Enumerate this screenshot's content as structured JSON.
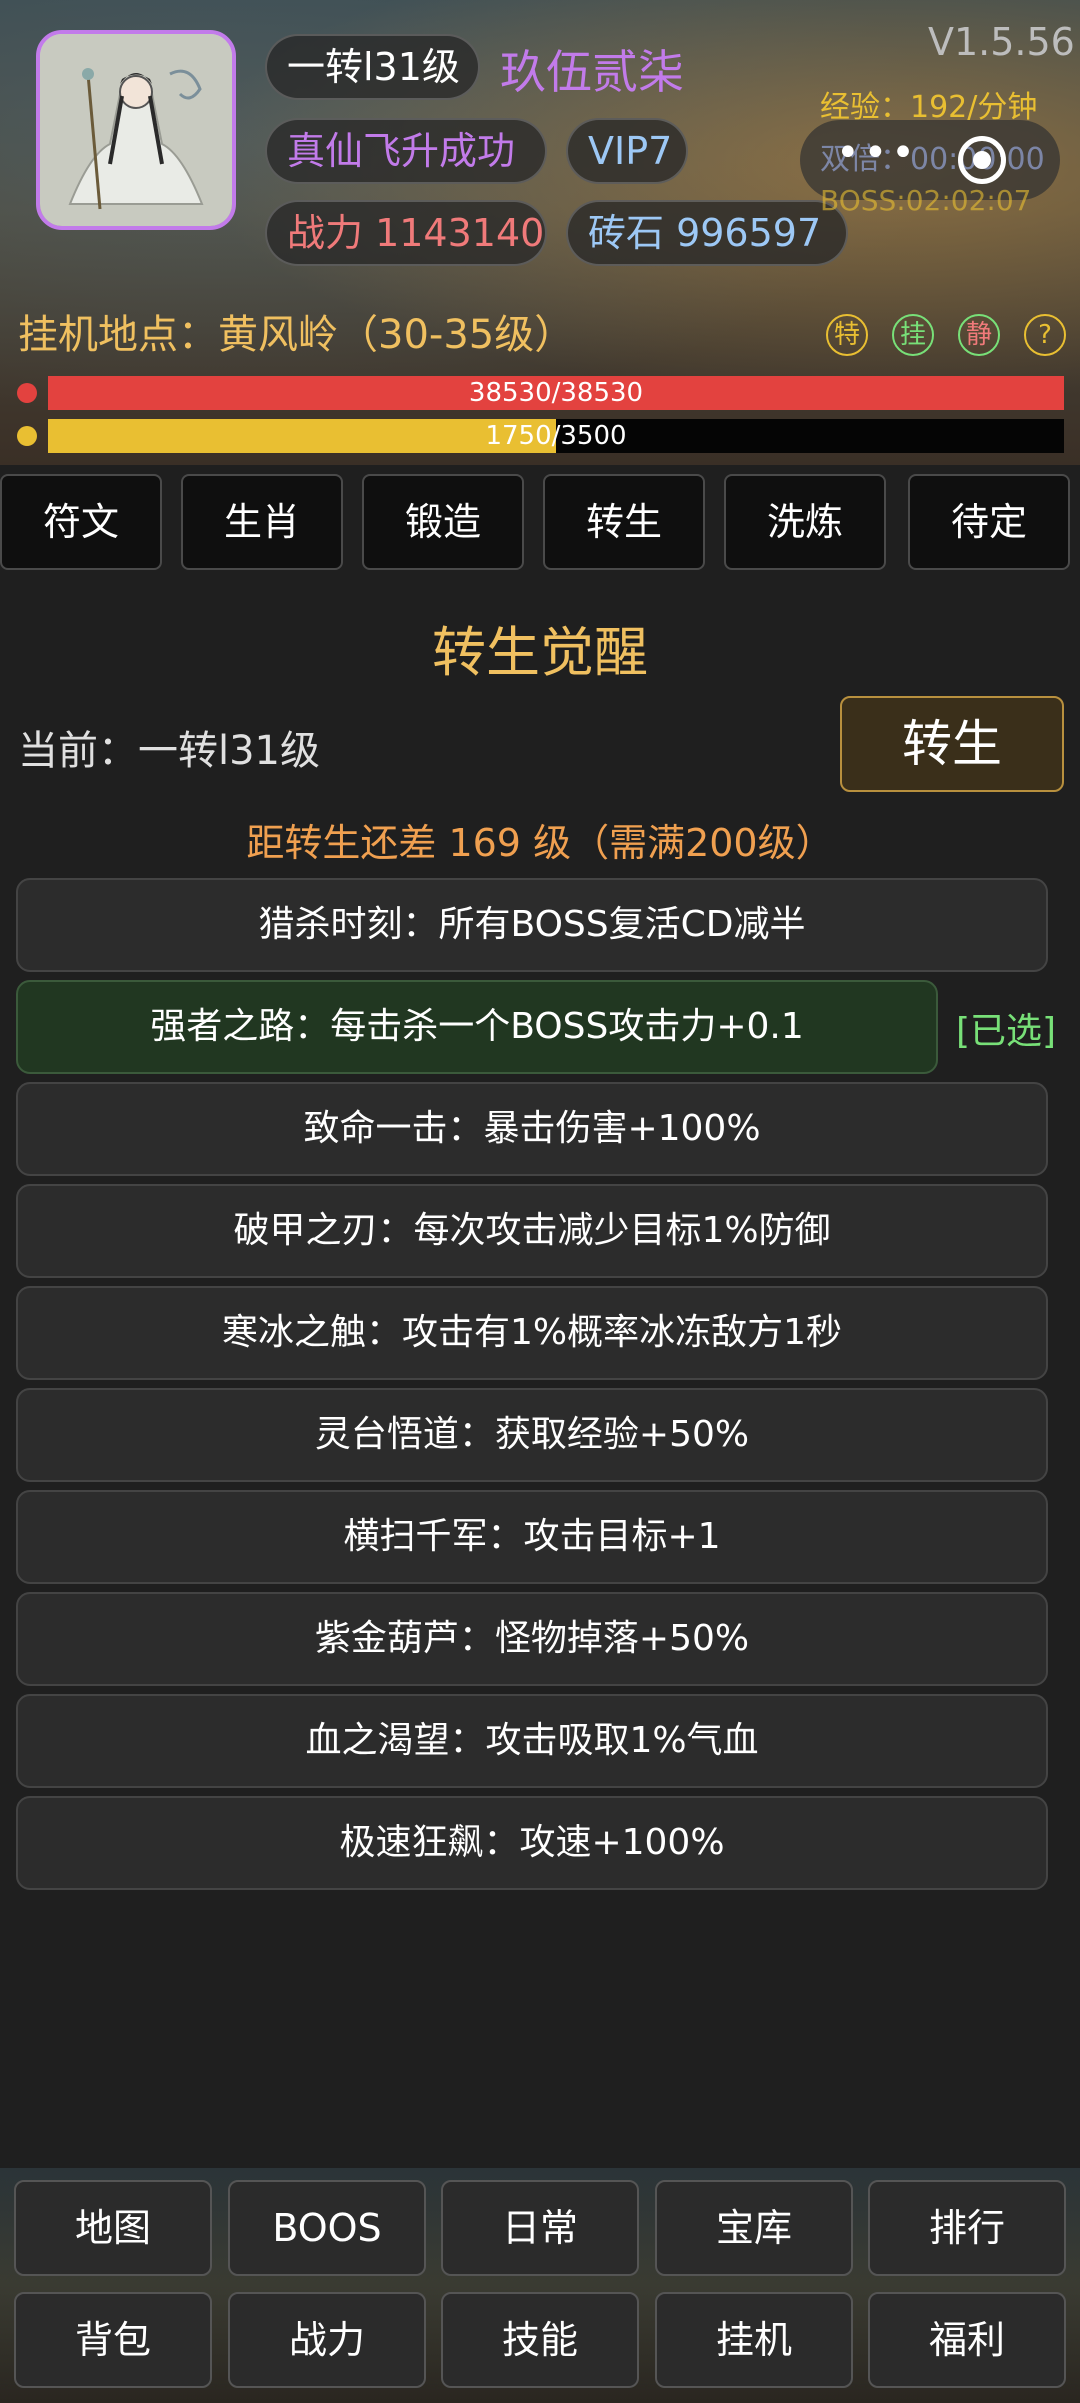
{
  "header": {
    "version": "V1.5.56",
    "level": "一转l31级",
    "player_name": "玖伍贰柒",
    "ascension_status": "真仙飞升成功",
    "vip": "VIP7",
    "power_label": "战力 1143140",
    "gems_label": "砖石 996597",
    "exp_rate": "经验：192/分钟",
    "double_label": "双倍：00:00:00",
    "boss_timer": "BOSS:02:02:07",
    "location": "挂机地点：黄风岭（30-35级）",
    "status_icons": [
      "特",
      "挂",
      "静",
      "?"
    ],
    "hp": {
      "current": 38530,
      "max": 38530,
      "text": "38530/38530",
      "fraction": 1.0
    },
    "mp": {
      "current": 1750,
      "max": 3500,
      "text": "1750/3500",
      "fraction": 0.5
    }
  },
  "colors": {
    "hp": "#e3423f",
    "mp": "#e9bf32",
    "accent_gold": "#f0c060",
    "name_purple": "#c27bea",
    "power_red": "#f07a7a",
    "gems_blue": "#9dc8f5",
    "selected_green": "#78e078",
    "warning_orange": "#f0a050"
  },
  "tabs": [
    "符文",
    "生肖",
    "锻造",
    "转生",
    "洗炼",
    "待定"
  ],
  "main": {
    "title": "转生觉醒",
    "current": "当前：一转l31级",
    "rebirth_button": "转生",
    "requirement": "距转生还差 169 级（需满200级）",
    "selected_tag": "[已选]",
    "options": [
      {
        "label": "猎杀时刻：所有BOSS复活CD减半",
        "selected": false
      },
      {
        "label": "强者之路：每击杀一个BOSS攻击力+0.1",
        "selected": true
      },
      {
        "label": "致命一击：暴击伤害+100%",
        "selected": false
      },
      {
        "label": "破甲之刃：每次攻击减少目标1%防御",
        "selected": false
      },
      {
        "label": "寒冰之触：攻击有1%概率冰冻敌方1秒",
        "selected": false
      },
      {
        "label": "灵台悟道：获取经验+50%",
        "selected": false
      },
      {
        "label": "横扫千军：攻击目标+1",
        "selected": false
      },
      {
        "label": "紫金葫芦：怪物掉落+50%",
        "selected": false
      },
      {
        "label": "血之渴望：攻击吸取1%气血",
        "selected": false
      },
      {
        "label": "极速狂飙：攻速+100%",
        "selected": false
      }
    ]
  },
  "bottom_nav": {
    "row1": [
      "地图",
      "BOOS",
      "日常",
      "宝库",
      "排行"
    ],
    "row2": [
      "背包",
      "战力",
      "技能",
      "挂机",
      "福利"
    ]
  }
}
